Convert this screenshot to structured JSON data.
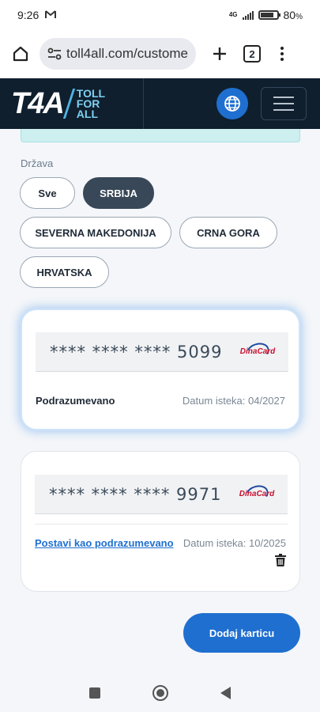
{
  "status_bar": {
    "time": "9:26",
    "mail_icon": "gmail-icon",
    "network": "4G",
    "battery": "80",
    "battery_unit": "%",
    "battery_level": 0.8
  },
  "browser": {
    "url": "toll4all.com/custome",
    "tab_count": "2"
  },
  "site_header": {
    "logo_mark": "T4A",
    "logo_words": [
      "TOLL",
      "FOR",
      "ALL"
    ],
    "accent_color": "#1f6fd0"
  },
  "filter": {
    "label": "Država",
    "chips": [
      {
        "label": "Sve",
        "active": false
      },
      {
        "label": "SRBIJA",
        "active": true
      },
      {
        "label": "SEVERNA MAKEDONIJA",
        "active": false
      },
      {
        "label": "CRNA GORA",
        "active": false
      },
      {
        "label": "HRVATSKA",
        "active": false
      }
    ]
  },
  "cards": [
    {
      "number": "**** **** **** 5099",
      "brand": "DinaCard",
      "status_text": "Podrazumevano",
      "expiry": "Datum isteka: 04/2027",
      "is_default": true
    },
    {
      "number": "**** **** **** 9971",
      "brand": "DinaCard",
      "action_text": "Postavi kao podrazumevano",
      "expiry": "Datum isteka: 10/2025",
      "is_default": false
    }
  ],
  "add_button": "Dodaj karticu"
}
